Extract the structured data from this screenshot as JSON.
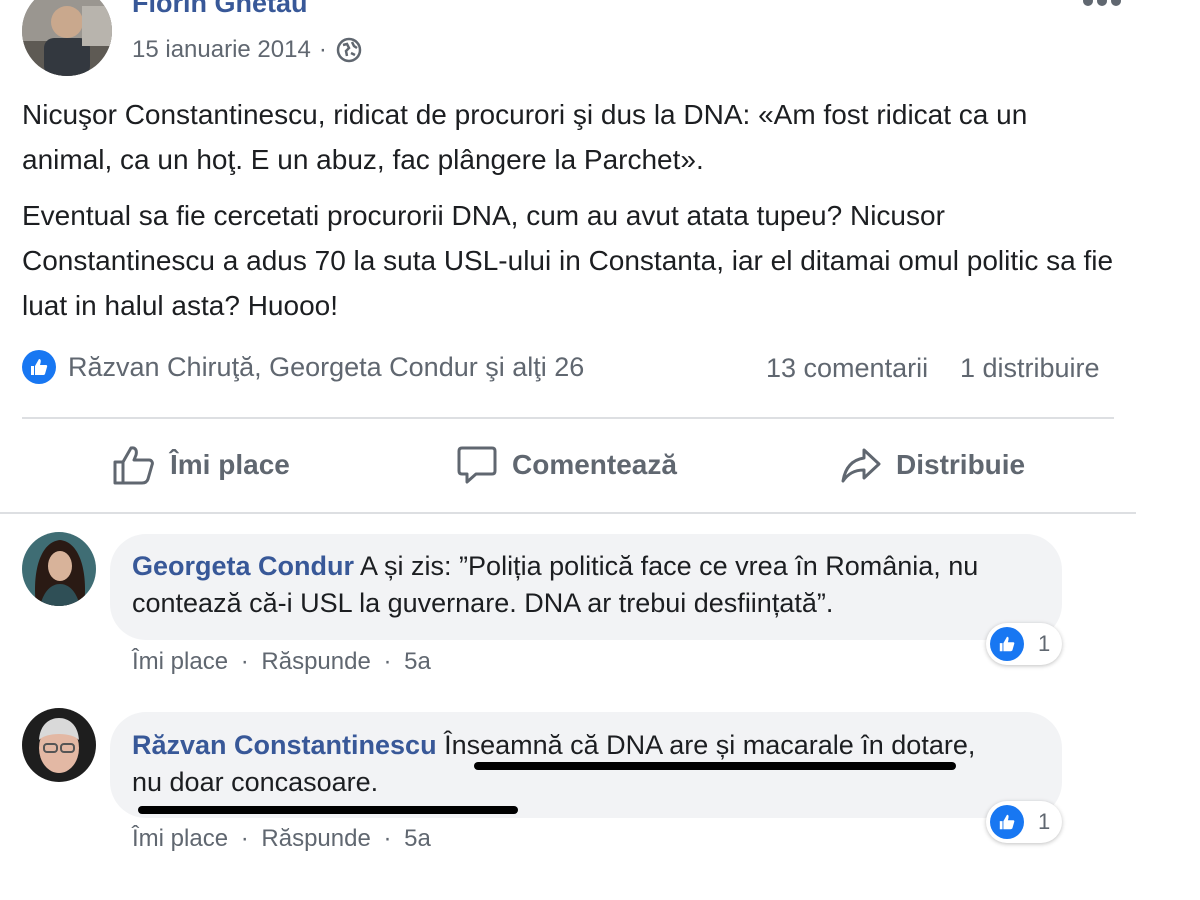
{
  "post": {
    "author": "Florin Ghetau",
    "date": "15 ianuarie 2014",
    "date_separator": "·",
    "paragraph1": "Nicuşor Constantinescu, ridicat de procurori şi dus la DNA: «Am fost ridicat ca un animal, ca un hoţ. E un abuz, fac plângere la Parchet».",
    "paragraph2": "Eventual sa fie cercetati procurorii DNA, cum au avut atata tupeu? Nicusor Constantinescu a adus 70 la suta USL-ului in Constanta, iar el ditamai omul politic sa fie luat in halul asta? Huooo!",
    "reactions_text": "Răzvan Chiruţă, Georgeta Condur şi alţi 26",
    "comments_count": "13 comentarii",
    "shares_count": "1 distribuire"
  },
  "actions": {
    "like": "Îmi place",
    "comment": "Comentează",
    "share": "Distribuie"
  },
  "comments": [
    {
      "author": "Georgeta Condur",
      "text": "A și zis: ”Poliția politică face ce vrea în România, nu contează că-i USL la guvernare. DNA ar trebui desființată”.",
      "like_label": "Îmi place",
      "reply_label": "Răspunde",
      "time": "5a",
      "separator": "·",
      "likes": "1"
    },
    {
      "author": "Răzvan Constantinescu",
      "text": "Înseamnă că DNA are și macarale în dotare, nu doar concasoare.",
      "like_label": "Îmi place",
      "reply_label": "Răspunde",
      "time": "5a",
      "separator": "·",
      "likes": "1"
    }
  ],
  "icons": {
    "more": "more-options-icon",
    "globe": "globe-icon",
    "thumb": "thumbs-up-icon",
    "comment": "comment-bubble-icon",
    "share": "share-arrow-icon"
  },
  "colors": {
    "link": "#385898",
    "like_blue": "#1877f2",
    "meta_gray": "#606770",
    "bubble": "#f2f3f5"
  }
}
